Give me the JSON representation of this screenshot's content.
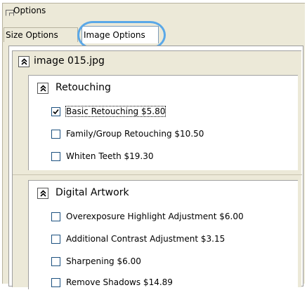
{
  "window": {
    "title": "Options",
    "icon": "window-corner-icon"
  },
  "tabs": [
    {
      "label": "Size Options",
      "active": false
    },
    {
      "label": "Image Options",
      "active": true
    }
  ],
  "image_panel": {
    "filename": "image 015.jpg",
    "collapse_icon": "double-chevron-up-icon",
    "groups": [
      {
        "label": "Retouching",
        "options": [
          {
            "label": "Basic Retouching $5.80",
            "checked": true
          },
          {
            "label": "Family/Group Retouching $10.50",
            "checked": false
          },
          {
            "label": "Whiten Teeth $19.30",
            "checked": false
          }
        ]
      },
      {
        "label": "Digital Artwork",
        "options": [
          {
            "label": "Overexposure Highlight Adjustment $6.00",
            "checked": false
          },
          {
            "label": "Additional Contrast Adjustment $3.15",
            "checked": false
          },
          {
            "label": "Sharpening $6.00",
            "checked": false
          },
          {
            "label": "Remove Shadows $14.89",
            "checked": false
          }
        ]
      }
    ]
  },
  "colors": {
    "panel_bg": "#ece9d8",
    "highlight_ring": "#5aa8e8",
    "checkbox_border": "#1c5180"
  }
}
